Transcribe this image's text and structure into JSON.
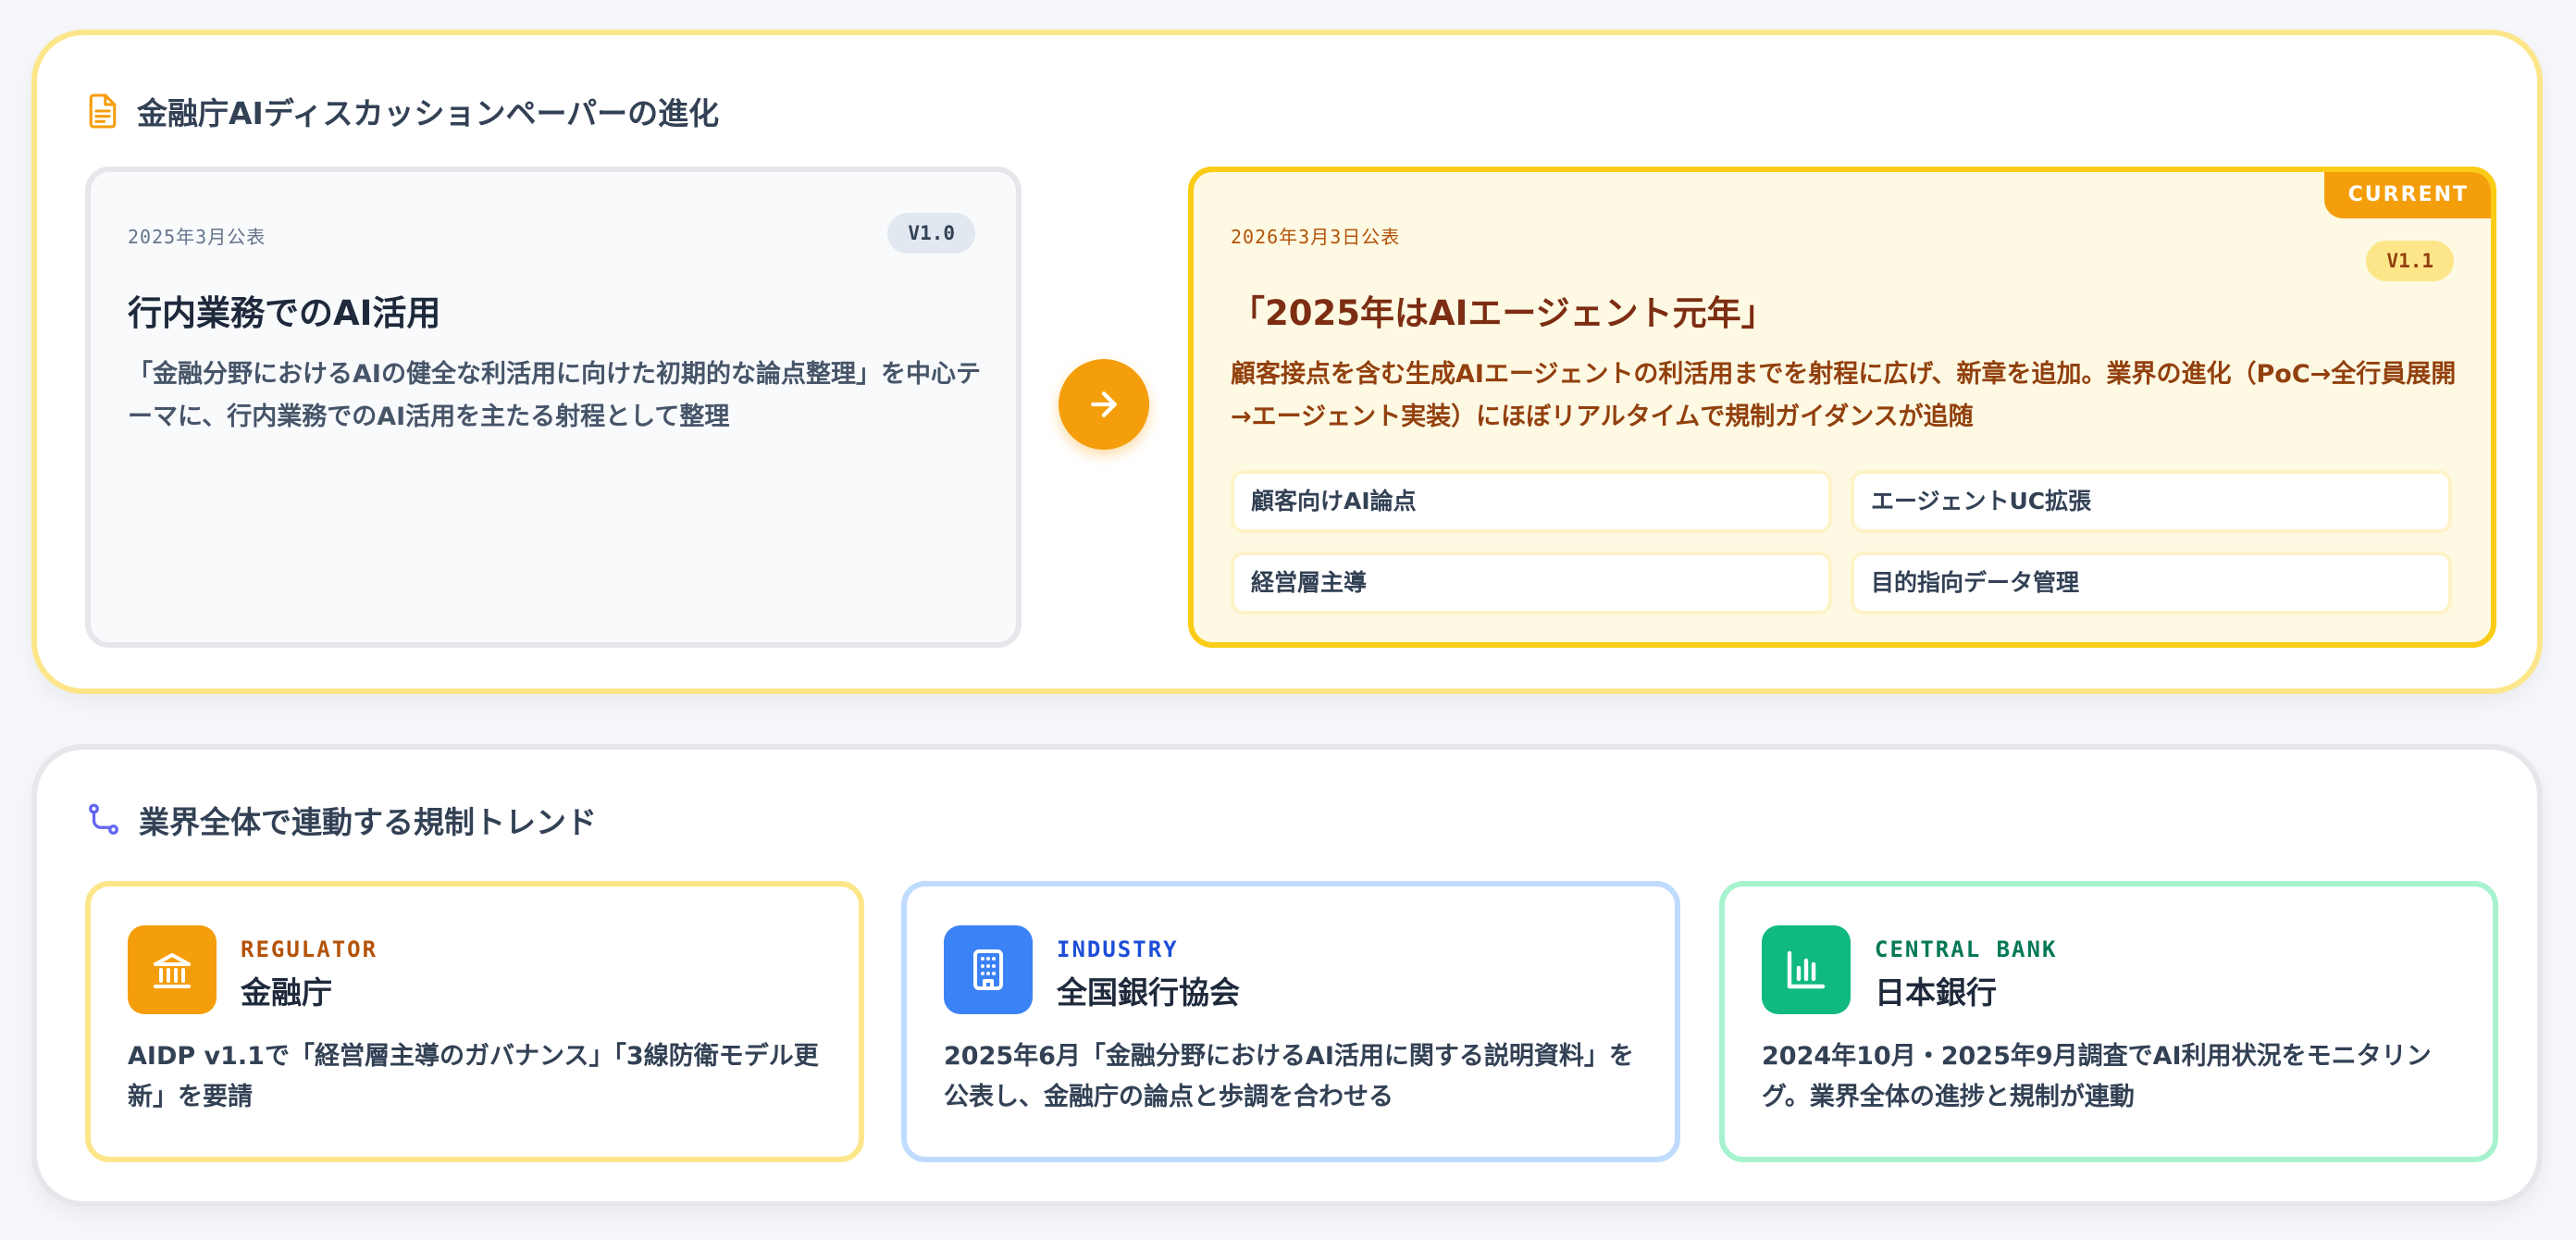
{
  "evolution": {
    "title": "金融庁AIディスカッションペーパーの進化",
    "old": {
      "date": "2025年3月公表",
      "version": "V1.0",
      "title": "行内業務でのAI活用",
      "description": "「金融分野におけるAIの健全な利活用に向けた初期的な論点整理」を中心テーマに、行内業務でのAI活用を主たる射程として整理"
    },
    "new": {
      "tag": "CURRENT",
      "date": "2026年3月3日公表",
      "version": "V1.1",
      "title": "「2025年はAIエージェント元年」",
      "description": "顧客接点を含む生成AIエージェントの利活用までを射程に広げ、新章を追加。業界の進化（PoC→全行員展開→エージェント実装）にほぼリアルタイムで規制ガイダンスが追随",
      "chips": [
        "顧客向けAI論点",
        "エージェントUC拡張",
        "経営層主導",
        "目的指向データ管理"
      ]
    }
  },
  "trend": {
    "title": "業界全体で連動する規制トレンド",
    "orgs": [
      {
        "category": "REGULATOR",
        "name": "金融庁",
        "description": "AIDP v1.1で「経営層主導のガバナンス」「3線防衛モデル更新」を要請",
        "icon": "bank-icon"
      },
      {
        "category": "INDUSTRY",
        "name": "全国銀行協会",
        "description": "2025年6月「金融分野におけるAI活用に関する説明資料」を公表し、金融庁の論点と歩調を合わせる",
        "icon": "building-icon"
      },
      {
        "category": "CENTRAL BANK",
        "name": "日本銀行",
        "description": "2024年10月・2025年9月調査でAI利用状況をモニタリング。業界全体の進捗と規制が連動",
        "icon": "bar-chart-icon"
      }
    ]
  },
  "colors": {
    "accent": "#f59e0b",
    "blue": "#3b82f6",
    "green": "#10b981"
  }
}
